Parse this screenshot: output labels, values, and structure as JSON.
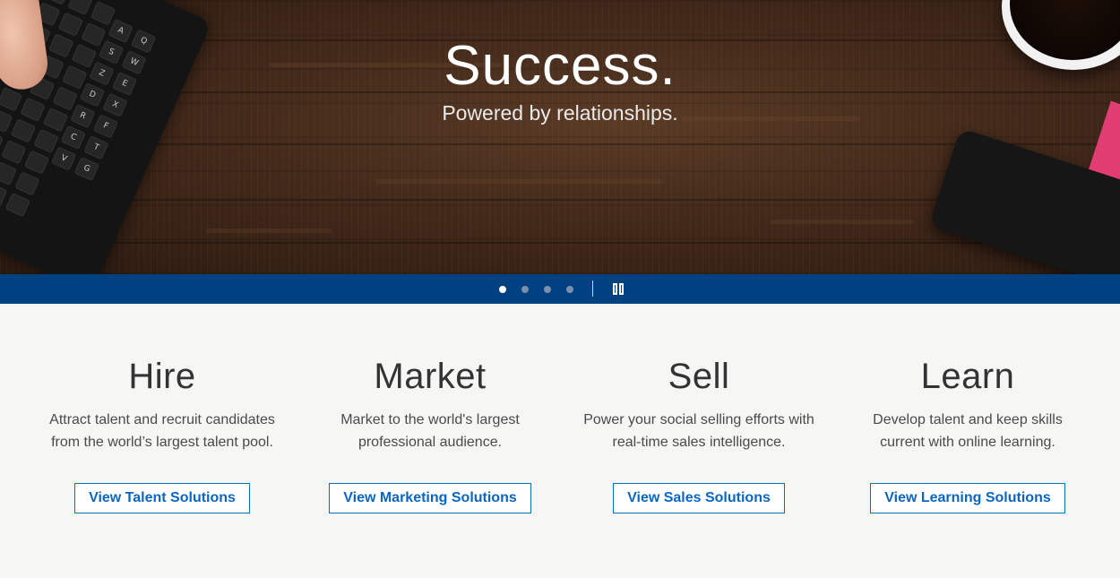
{
  "hero": {
    "title": "Success.",
    "subtitle": "Powered by relationships.",
    "keyboard_keys": [
      "A",
      "Q",
      "S",
      "W",
      "Z",
      "E",
      "D",
      "X",
      "R",
      "F",
      "C",
      "T",
      "V",
      "G"
    ]
  },
  "carousel": {
    "slide_count": 4,
    "active_index": 0,
    "pause_icon": "pause-icon"
  },
  "solutions": [
    {
      "heading": "Hire",
      "line1": "Attract talent and recruit candidates",
      "line2": "from the world’s largest talent pool.",
      "button": "View Talent Solutions"
    },
    {
      "heading": "Market",
      "line1": "Market to the world's largest",
      "line2": "professional audience.",
      "button": "View Marketing Solutions"
    },
    {
      "heading": "Sell",
      "line1": "Power your social selling efforts with",
      "line2": "real-time sales intelligence.",
      "button": "View Sales Solutions"
    },
    {
      "heading": "Learn",
      "line1": "Develop talent and keep skills",
      "line2": "current with online learning.",
      "button": "View Learning Solutions"
    }
  ],
  "colors": {
    "bar": "#004182",
    "link": "#0a66c2",
    "background": "#f6f6f5"
  }
}
